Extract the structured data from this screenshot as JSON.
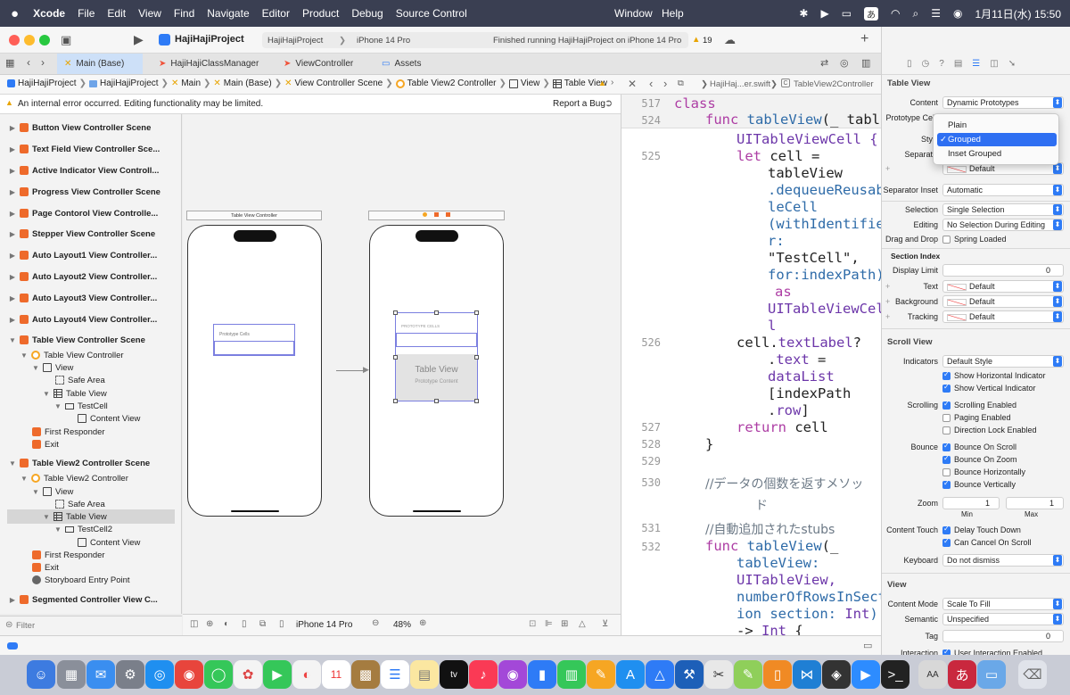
{
  "menubar": {
    "app": "Xcode",
    "items": [
      "File",
      "Edit",
      "View",
      "Find",
      "Navigate",
      "Editor",
      "Product",
      "Debug",
      "Source Control"
    ],
    "right_items": [
      "Window",
      "Help"
    ],
    "input_badge": "あ",
    "clock": "1月11日(水) 15:50"
  },
  "toolbar": {
    "project": "HajiHajiProject",
    "scheme": "HajiHajiProject",
    "device": "iPhone 14 Pro",
    "status": "Finished running HajiHajiProject on iPhone 14 Pro",
    "warning_count": "19"
  },
  "tabs": [
    "Main (Base)",
    "HajiHajiClassManager",
    "ViewController",
    "Assets"
  ],
  "jumpbar": [
    "HajiHajiProject",
    "HajiHajiProject",
    "Main",
    "Main (Base)",
    "View Controller Scene",
    "Table View2 Controller",
    "View",
    "Table View"
  ],
  "warning": {
    "text": "An internal error occurred. Editing functionality may be limited.",
    "action": "Report a Bug"
  },
  "navigator": {
    "scenes_collapsed": [
      "Button View Controller Scene",
      "Text Field View Controller Sce...",
      "Active Indicator View Controll...",
      "Progress View Controller Scene",
      "Page Contorol View Controlle...",
      "Stepper View Controller Scene",
      "Auto Layout1 View Controller...",
      "Auto Layout2 View Controller...",
      "Auto Layout3 View Controller...",
      "Auto Layout4 View Controller..."
    ],
    "scene1": {
      "title": "Table View Controller Scene",
      "controller": "Table View Controller",
      "view": "View",
      "safe_area": "Safe Area",
      "table_view": "Table View",
      "cell": "TestCell",
      "content_view": "Content View",
      "first_responder": "First Responder",
      "exit": "Exit"
    },
    "scene2": {
      "title": "Table View2 Controller Scene",
      "controller": "Table View2 Controller",
      "view": "View",
      "safe_area": "Safe Area",
      "table_view": "Table View",
      "cell": "TestCell2",
      "content_view": "Content View",
      "first_responder": "First Responder",
      "exit": "Exit",
      "entry": "Storyboard Entry Point"
    },
    "last_scene": "Segmented Controller View C...",
    "filter_placeholder": "Filter"
  },
  "canvas": {
    "left_bar": "Table View Controller",
    "left_prototype": "Prototype Cells",
    "right_prototype": "PROTOTYPE CELLS",
    "table_view_title": "Table View",
    "table_view_sub": "Prototype Content",
    "device": "iPhone 14 Pro",
    "zoom": "48%"
  },
  "editor": {
    "breadcrumb_file": "HajiHaj...er.swift",
    "breadcrumb_class": "TableView2Controller",
    "lines": [
      {
        "n": "517",
        "t": "class"
      },
      {
        "n": "524",
        "t": "func tableView(_ tabl..."
      },
      {
        "n": "",
        "t": "UITableViewCell {"
      },
      {
        "n": "525",
        "t": "let cell ="
      },
      {
        "n": "",
        "t": "tableView"
      },
      {
        "n": "",
        "t": ".dequeueReusab"
      },
      {
        "n": "",
        "t": "leCell"
      },
      {
        "n": "",
        "t": "(withIdentifie"
      },
      {
        "n": "",
        "t": "r:"
      },
      {
        "n": "",
        "t": "\"TestCell\","
      },
      {
        "n": "",
        "t": "for:indexPath)"
      },
      {
        "n": "",
        "t": "as"
      },
      {
        "n": "",
        "t": "UITableViewCel"
      },
      {
        "n": "",
        "t": "l"
      },
      {
        "n": "526",
        "t": "cell.textLabel?"
      },
      {
        "n": "",
        "t": ".text ="
      },
      {
        "n": "",
        "t": "dataList"
      },
      {
        "n": "",
        "t": "[indexPath"
      },
      {
        "n": "",
        "t": ".row]"
      },
      {
        "n": "527",
        "t": "return cell"
      },
      {
        "n": "528",
        "t": "}"
      },
      {
        "n": "529",
        "t": ""
      },
      {
        "n": "530",
        "t": "//データの個数を返すメソッ"
      },
      {
        "n": "",
        "t": "ド"
      },
      {
        "n": "531",
        "t": "//自動追加されたstubs"
      },
      {
        "n": "532",
        "t": "func tableView(_"
      },
      {
        "n": "",
        "t": "tableView:"
      },
      {
        "n": "",
        "t": "UITableView,"
      },
      {
        "n": "",
        "t": "numberOfRowsInSect"
      },
      {
        "n": "",
        "t": "ion section: Int)"
      },
      {
        "n": "",
        "t": "-> Int {"
      }
    ]
  },
  "inspector": {
    "table_view_header": "Table View",
    "content_label": "Content",
    "content_value": "Dynamic Prototypes",
    "prototype_label": "Prototype Cel",
    "style_label": "Sty",
    "separator_label": "Separat",
    "separator_value": "Default",
    "style_options": [
      "Plain",
      "Grouped",
      "Inset Grouped"
    ],
    "style_selected": "Grouped",
    "sep_inset_label": "Separator Inset",
    "sep_inset_value": "Automatic",
    "selection_label": "Selection",
    "selection_value": "Single Selection",
    "editing_label": "Editing",
    "editing_value": "No Selection During Editing",
    "dragdrop_label": "Drag and Drop",
    "dragdrop_value": "Spring Loaded",
    "section_index": "Section Index",
    "display_limit_label": "Display Limit",
    "display_limit_value": "0",
    "text_label": "Text",
    "text_value": "Default",
    "background_label": "Background",
    "background_value": "Default",
    "tracking_label": "Tracking",
    "tracking_value": "Default",
    "scroll_view_header": "Scroll View",
    "indicators_label": "Indicators",
    "indicators_value": "Default Style",
    "show_h": "Show Horizontal Indicator",
    "show_v": "Show Vertical Indicator",
    "scrolling_label": "Scrolling",
    "scrolling_enabled": "Scrolling Enabled",
    "paging_enabled": "Paging Enabled",
    "direction_lock": "Direction Lock Enabled",
    "bounce_label": "Bounce",
    "bounce_scroll": "Bounce On Scroll",
    "bounce_zoom": "Bounce On Zoom",
    "bounce_h": "Bounce Horizontally",
    "bounce_v": "Bounce Vertically",
    "zoom_label": "Zoom",
    "zoom_min": "1",
    "zoom_max": "1",
    "min_label": "Min",
    "max_label": "Max",
    "content_touch_label": "Content Touch",
    "delay_touch": "Delay Touch Down",
    "can_cancel": "Can Cancel On Scroll",
    "keyboard_label": "Keyboard",
    "keyboard_value": "Do not dismiss",
    "view_header": "View",
    "content_mode_label": "Content Mode",
    "content_mode_value": "Scale To Fill",
    "semantic_label": "Semantic",
    "semantic_value": "Unspecified",
    "tag_label": "Tag",
    "tag_value": "0",
    "interaction_label": "Interaction",
    "interaction_value": "User Interaction Enabled"
  }
}
